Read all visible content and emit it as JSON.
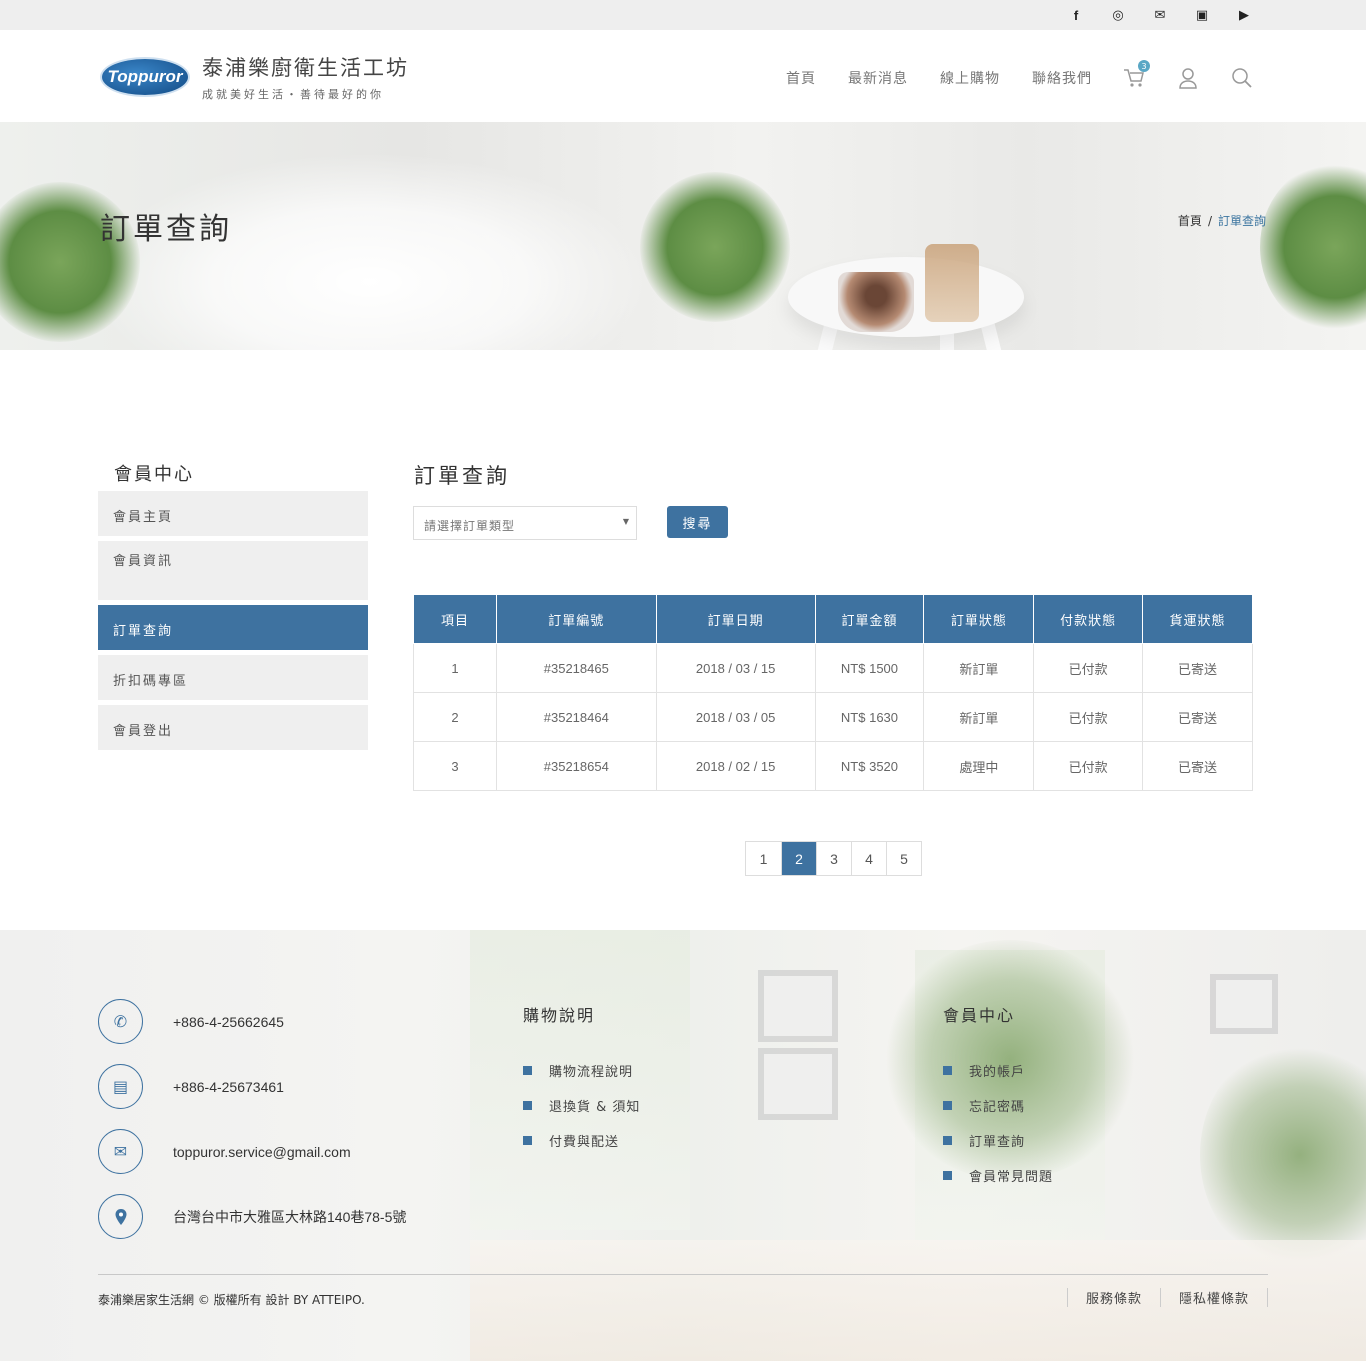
{
  "topbar": {
    "social": [
      {
        "icon": "facebook-icon",
        "glyph": "f"
      },
      {
        "icon": "instagram-icon",
        "glyph": "◎"
      },
      {
        "icon": "mail-icon",
        "glyph": "✉"
      },
      {
        "icon": "line-icon",
        "glyph": "▣"
      },
      {
        "icon": "youtube-icon",
        "glyph": "▶"
      }
    ]
  },
  "header": {
    "logo_mark": "Toppuror",
    "logo_title": "泰浦樂廚衛生活工坊",
    "logo_sub": "成就美好生活・善待最好的你",
    "nav": [
      "首頁",
      "最新消息",
      "線上購物",
      "聯絡我們"
    ],
    "cart_count": "3"
  },
  "banner": {
    "title": "訂單查詢",
    "breadcrumb_home": "首頁",
    "breadcrumb_sep": "/",
    "breadcrumb_current": "訂單查詢"
  },
  "sidebar": {
    "title": "會員中心",
    "items": [
      "會員主頁",
      "會員資訊",
      "訂單查詢",
      "折扣碼專區",
      "會員登出"
    ],
    "active_index": 2
  },
  "main": {
    "title": "訂單查詢",
    "select_placeholder": "請選擇訂單類型",
    "search_button": "搜尋",
    "columns": [
      "項目",
      "訂單編號",
      "訂單日期",
      "訂單金額",
      "訂單狀態",
      "付款狀態",
      "貨運狀態"
    ],
    "rows": [
      [
        "1",
        "#35218465",
        "2018 / 03 / 15",
        "NT$ 1500",
        "新訂單",
        "已付款",
        "已寄送"
      ],
      [
        "2",
        "#35218464",
        "2018 / 03 / 05",
        "NT$ 1630",
        "新訂單",
        "已付款",
        "已寄送"
      ],
      [
        "3",
        "#35218654",
        "2018 / 02 / 15",
        "NT$ 3520",
        "處理中",
        "已付款",
        "已寄送"
      ]
    ],
    "pages": [
      "1",
      "2",
      "3",
      "4",
      "5"
    ],
    "current_page": "2"
  },
  "footer": {
    "contacts": [
      {
        "icon": "phone-icon",
        "glyph": "✆",
        "text": "+886-4-25662645"
      },
      {
        "icon": "fax-icon",
        "glyph": "▤",
        "text": "+886-4-25673461"
      },
      {
        "icon": "mail-icon",
        "glyph": "✉",
        "text": "toppuror.service@gmail.com"
      },
      {
        "icon": "location-icon",
        "glyph": "⬤",
        "text": "台灣台中市大雅區大林路140巷78-5號"
      }
    ],
    "shopping": {
      "title": "購物說明",
      "items": [
        "購物流程說明",
        "退換貨 & 須知",
        "付費與配送"
      ]
    },
    "member": {
      "title": "會員中心",
      "items": [
        "我的帳戶",
        "忘記密碼",
        "訂單查詢",
        "會員常見問題"
      ]
    },
    "copyright": "泰浦樂居家生活網 © 版權所有 設計 BY ATTEIPO.",
    "links": [
      "服務條款",
      "隱私權條款"
    ]
  },
  "colors": {
    "accent": "#3e72a0",
    "topbar_bg": "#eeeeee",
    "sidebar_bg": "#efefef"
  }
}
